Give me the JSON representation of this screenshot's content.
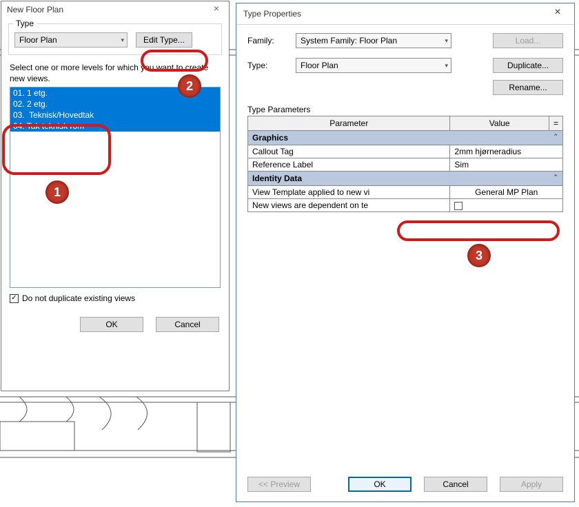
{
  "left_dialog": {
    "title": "New Floor Plan",
    "type_group_label": "Type",
    "type_combo": "Floor Plan",
    "edit_type_btn": "Edit Type...",
    "instruction": "Select one or more levels for which you want to create new views.",
    "levels": [
      "01. 1 etg.",
      "02. 2 etg.",
      "03.  Teknisk/Hovedtak",
      "04. Tak teknisk rom"
    ],
    "no_dup_label": "Do not duplicate existing views",
    "no_dup_checked": "✓",
    "ok": "OK",
    "cancel": "Cancel"
  },
  "right_dialog": {
    "title": "Type Properties",
    "family_label": "Family:",
    "family_value": "System Family: Floor Plan",
    "type_label": "Type:",
    "type_value": "Floor Plan",
    "load_btn": "Load...",
    "duplicate_btn": "Duplicate...",
    "rename_btn": "Rename...",
    "params_label": "Type Parameters",
    "col_param": "Parameter",
    "col_value": "Value",
    "col_eq": "=",
    "group_graphics": "Graphics",
    "row_callout_tag_param": "Callout Tag",
    "row_callout_tag_val": "2mm hjørneradius",
    "row_reflabel_param": "Reference Label",
    "row_reflabel_val": "Sim",
    "group_identity": "Identity Data",
    "row_viewtpl_param": "View Template applied to new vi",
    "row_viewtpl_val": "General MP Plan",
    "row_depend_param": "New views are dependent on te",
    "preview_btn": "<< Preview",
    "ok": "OK",
    "cancel": "Cancel",
    "apply": "Apply"
  },
  "annotations": {
    "b1": "1",
    "b2": "2",
    "b3": "3"
  }
}
